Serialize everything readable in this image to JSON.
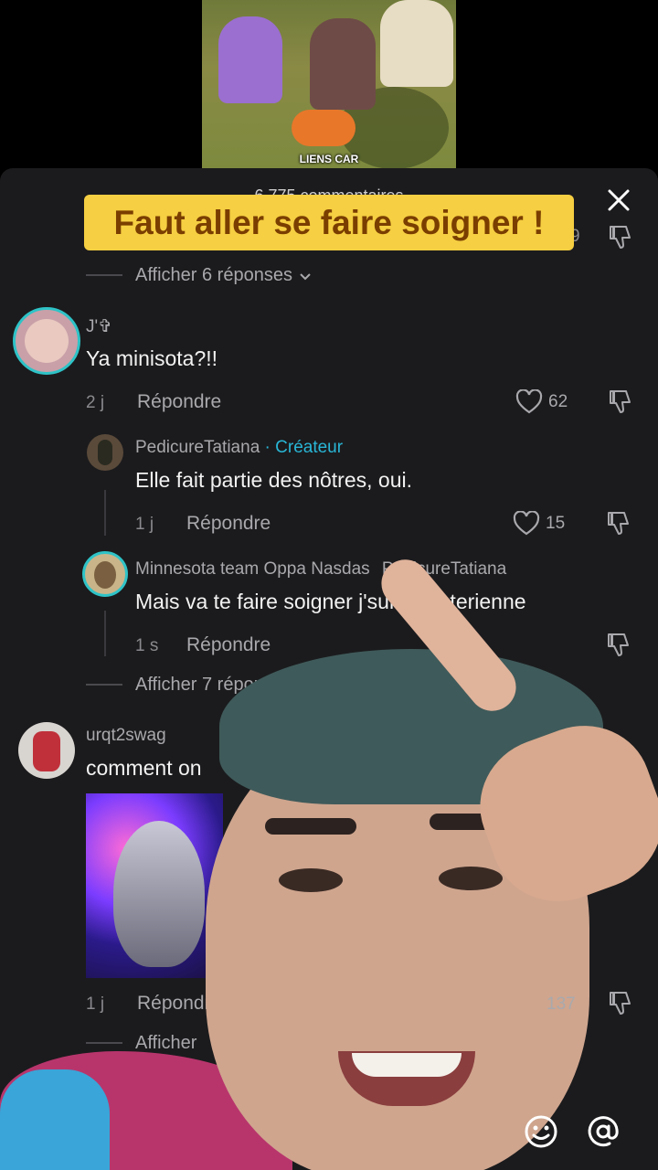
{
  "video": {
    "caption": "LIENS CAR"
  },
  "panel": {
    "title": "6 775 commentaires"
  },
  "overlay_caption": "Faut aller se faire soigner !",
  "top_partial": {
    "like_count": "9"
  },
  "show_replies_1": "Afficher 6 réponses",
  "comment1": {
    "username": "J'✞",
    "text": "Ya minisota?!!",
    "time": "2 j",
    "reply_label": "Répondre",
    "likes": "62"
  },
  "reply1": {
    "username": "PedicureTatiana",
    "creator_badge": "· Créateur",
    "text": "Elle fait partie des nôtres, oui.",
    "time": "1 j",
    "reply_label": "Répondre",
    "likes": "15"
  },
  "reply2": {
    "username": "Minnesota team Oppa Nasdas",
    "mention": "PedicureTatiana",
    "text": "Mais va te faire soigner j'suis pas terienne",
    "time": "1 s",
    "reply_label": "Répondre"
  },
  "show_replies_2": "Afficher 7 répon",
  "comment2": {
    "username": "urqt2swag",
    "text": "comment on",
    "time": "1 j",
    "reply_label": "Répondr",
    "likes": "137"
  },
  "show_replies_3": "Afficher",
  "colors": {
    "panel": "#1b1b1d",
    "creator": "#29b6d6",
    "caption_bg": "#f6cf42",
    "caption_text": "#7a3e00"
  },
  "icons": [
    "close-icon",
    "heart-icon",
    "dislike-icon",
    "chevron-down-icon",
    "emoji-icon",
    "mention-icon"
  ]
}
